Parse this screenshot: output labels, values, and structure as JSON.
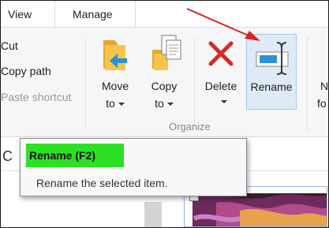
{
  "tabs": {
    "view": "View",
    "manage": "Manage"
  },
  "clipboard": {
    "cut": "Cut",
    "copy_path": "Copy path",
    "paste_shortcut": "Paste shortcut"
  },
  "organize": {
    "move_to": {
      "line1": "Move",
      "line2": "to"
    },
    "copy_to": {
      "line1": "Copy",
      "line2": "to"
    },
    "delete": "Delete",
    "rename": "Rename",
    "group_label": "Organize"
  },
  "new_group": {
    "line1": "N",
    "line2": "fo"
  },
  "address_fragment": "C",
  "tooltip": {
    "title": "Rename (F2)",
    "description": "Rename the selected item."
  },
  "colors": {
    "tooltip_highlight": "#2ee024",
    "arrow": "#d9231f",
    "folder": "#f5c44a",
    "arrow_blue": "#2d8fd9"
  }
}
